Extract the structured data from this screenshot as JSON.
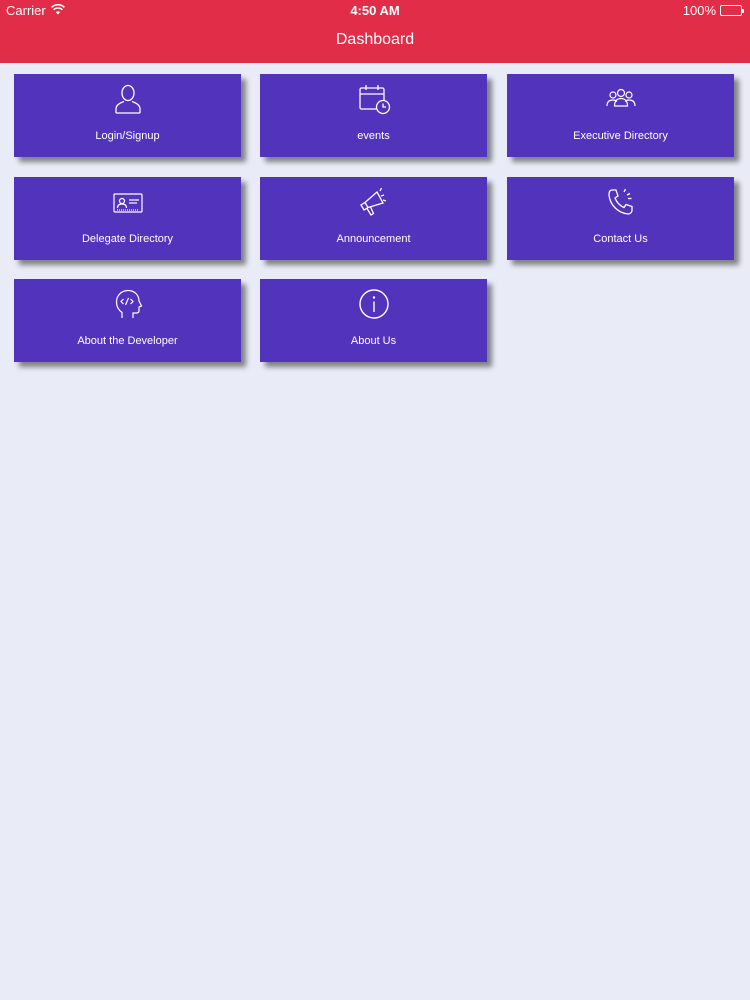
{
  "status_bar": {
    "carrier": "Carrier",
    "time": "4:50 AM",
    "battery": "100%"
  },
  "nav": {
    "title": "Dashboard"
  },
  "tiles": [
    {
      "label": "Login/Signup",
      "icon": "user-icon"
    },
    {
      "label": "events",
      "icon": "calendar-clock-icon"
    },
    {
      "label": "Executive Directory",
      "icon": "group-icon"
    },
    {
      "label": "Delegate Directory",
      "icon": "id-card-icon"
    },
    {
      "label": "Announcement",
      "icon": "megaphone-icon"
    },
    {
      "label": "Contact Us",
      "icon": "phone-icon"
    },
    {
      "label": "About the Developer",
      "icon": "developer-head-icon"
    },
    {
      "label": "About Us",
      "icon": "info-icon"
    }
  ],
  "colors": {
    "header": "#E12D48",
    "tile": "#5133BC",
    "background": "#E9EBF6",
    "text": "#FFFFFF"
  }
}
